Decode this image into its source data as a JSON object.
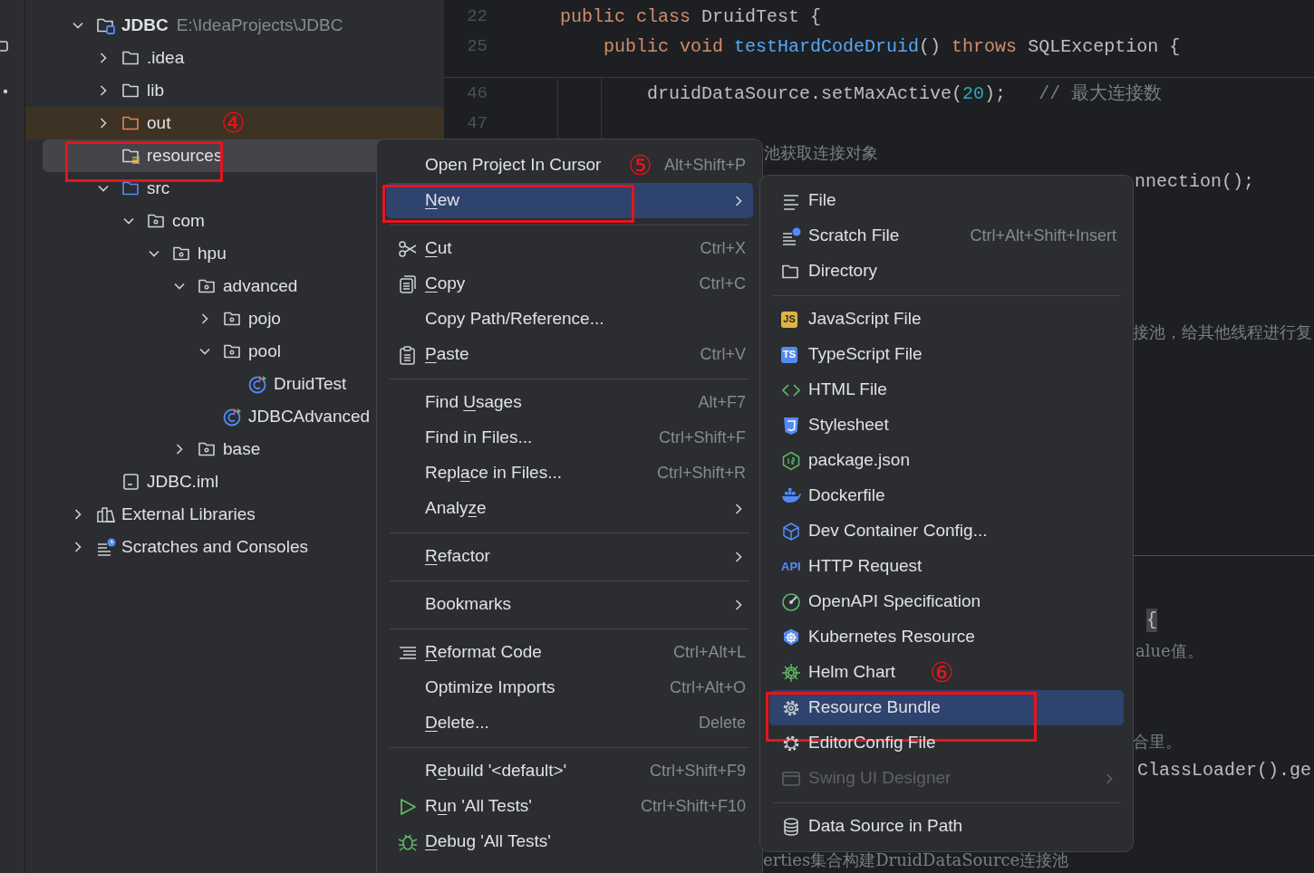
{
  "tree": [
    {
      "label": "JDBC",
      "path": "E:\\IdeaProjects\\JDBC",
      "kind": "project",
      "expanded": true,
      "selected": false,
      "children": [
        {
          "label": ".idea",
          "kind": "folder",
          "expanded": false,
          "selected": false
        },
        {
          "label": "lib",
          "kind": "folder",
          "expanded": false,
          "selected": false
        },
        {
          "label": "out",
          "kind": "excluded",
          "expanded": false,
          "selected": false,
          "callout": "④"
        },
        {
          "label": "resources",
          "kind": "resources",
          "selected": true,
          "boxed": true
        },
        {
          "label": "src",
          "kind": "source",
          "expanded": true,
          "selected": false,
          "children": [
            {
              "label": "com",
              "kind": "package",
              "expanded": true,
              "selected": false,
              "children": [
                {
                  "label": "hpu",
                  "kind": "package",
                  "expanded": true,
                  "selected": false,
                  "children": [
                    {
                      "label": "advanced",
                      "kind": "package",
                      "expanded": true,
                      "selected": false,
                      "children": [
                        {
                          "label": "pojo",
                          "kind": "package",
                          "expanded": false,
                          "selected": false
                        },
                        {
                          "label": "pool",
                          "kind": "package",
                          "expanded": true,
                          "selected": false,
                          "children": [
                            {
                              "label": "DruidTest",
                              "kind": "class",
                              "selected": false
                            }
                          ]
                        },
                        {
                          "label": "JDBCAdvanced",
                          "kind": "class",
                          "selected": false
                        }
                      ]
                    },
                    {
                      "label": "base",
                      "kind": "package",
                      "expanded": false,
                      "selected": false
                    }
                  ]
                }
              ]
            }
          ]
        },
        {
          "label": "JDBC.iml",
          "kind": "file",
          "selected": false
        }
      ]
    },
    {
      "label": "External Libraries",
      "kind": "libraries",
      "expanded": false,
      "selected": false
    },
    {
      "label": "Scratches and Consoles",
      "kind": "scratches",
      "expanded": false,
      "selected": false
    }
  ],
  "editor": {
    "sticky_lines": [
      {
        "number": "22",
        "tokens": [
          {
            "text": "    public class ",
            "kind": "keyword"
          },
          {
            "text": "DruidTest {",
            "kind": "plain"
          }
        ]
      },
      {
        "number": "25",
        "tokens": [
          {
            "text": "        public void ",
            "kind": "keyword"
          },
          {
            "text": "testHardCodeDruid",
            "kind": "method"
          },
          {
            "text": "() ",
            "kind": "plain"
          },
          {
            "text": "throws ",
            "kind": "keyword"
          },
          {
            "text": "SQLException {",
            "kind": "plain"
          }
        ]
      }
    ],
    "lines": [
      {
        "number": "46",
        "tokens": [
          {
            "text": "            druidDataSource.setMaxActive(",
            "kind": "plain"
          },
          {
            "text": "20",
            "kind": "number"
          },
          {
            "text": ");   ",
            "kind": "plain"
          },
          {
            "text": "// 最大连接数",
            "kind": "comment"
          }
        ]
      },
      {
        "number": "47"
      }
    ],
    "fragments": [
      {
        "text": "池获取连接对象",
        "kind": "comment"
      },
      {
        "text": "nnection();",
        "kind": "plain"
      },
      {
        "text": "接池，给其他线程进行复",
        "kind": "comment"
      },
      {
        "text": "{",
        "kind": "brace"
      },
      {
        "text": "alue值。",
        "kind": "comment"
      },
      {
        "text": "合里。",
        "kind": "comment"
      },
      {
        "text": "ClassLoader().ge",
        "kind": "plain"
      },
      {
        "text": "erties集合构建DruidDataSource连接池",
        "kind": "comment"
      }
    ]
  },
  "context_menu": [
    {
      "kind": "item",
      "label": "Open Project In Cursor",
      "shortcut": "Alt+Shift+P",
      "submenu": false,
      "selected": false,
      "callout": "⑤"
    },
    {
      "kind": "item",
      "label": {
        "key": "N",
        "post": "ew"
      },
      "submenu": true,
      "selected": true,
      "boxed": true
    },
    {
      "kind": "separator"
    },
    {
      "kind": "item",
      "label": {
        "key": "C",
        "post": "ut"
      },
      "shortcut": "Ctrl+X",
      "submenu": false,
      "selected": false
    },
    {
      "kind": "item",
      "label": {
        "key": "C",
        "post": "opy"
      },
      "shortcut": "Ctrl+C",
      "submenu": false,
      "selected": false
    },
    {
      "kind": "item",
      "label": "Copy Path/Reference...",
      "submenu": false,
      "selected": false
    },
    {
      "kind": "item",
      "label": {
        "key": "P",
        "post": "aste"
      },
      "shortcut": "Ctrl+V",
      "submenu": false,
      "selected": false
    },
    {
      "kind": "separator"
    },
    {
      "kind": "item",
      "label": {
        "pre": "Find ",
        "key": "U",
        "post": "sages"
      },
      "shortcut": "Alt+F7",
      "submenu": false,
      "selected": false
    },
    {
      "kind": "item",
      "label": "Find in Files...",
      "shortcut": "Ctrl+Shift+F",
      "submenu": false,
      "selected": false
    },
    {
      "kind": "item",
      "label": {
        "pre": "Repl",
        "key": "a",
        "post": "ce in Files..."
      },
      "shortcut": "Ctrl+Shift+R",
      "submenu": false,
      "selected": false
    },
    {
      "kind": "item",
      "label": {
        "pre": "Analy",
        "key": "z",
        "post": "e"
      },
      "submenu": true,
      "selected": false
    },
    {
      "kind": "separator"
    },
    {
      "kind": "item",
      "label": {
        "key": "R",
        "post": "efactor"
      },
      "submenu": true,
      "selected": false
    },
    {
      "kind": "separator"
    },
    {
      "kind": "item",
      "label": "Bookmarks",
      "submenu": true,
      "selected": false
    },
    {
      "kind": "separator"
    },
    {
      "kind": "item",
      "label": {
        "key": "R",
        "post": "eformat Code"
      },
      "shortcut": "Ctrl+Alt+L",
      "submenu": false,
      "selected": false
    },
    {
      "kind": "item",
      "label": "Optimize Imports",
      "shortcut": "Ctrl+Alt+O",
      "submenu": false,
      "selected": false
    },
    {
      "kind": "item",
      "label": {
        "key": "D",
        "post": "elete..."
      },
      "shortcut": "Delete",
      "submenu": false,
      "selected": false
    },
    {
      "kind": "separator"
    },
    {
      "kind": "item",
      "label": {
        "pre": "R",
        "key": "e",
        "post": "build '<default>'"
      },
      "shortcut": "Ctrl+Shift+F9",
      "submenu": false,
      "selected": false
    },
    {
      "kind": "item",
      "label": {
        "pre": "R",
        "key": "u",
        "post": "n 'All Tests'"
      },
      "shortcut": "Ctrl+Shift+F10",
      "submenu": false,
      "selected": false
    },
    {
      "kind": "item",
      "label": {
        "key": "D",
        "post": "ebug 'All Tests'"
      },
      "submenu": false,
      "selected": false
    }
  ],
  "new_submenu": [
    {
      "kind": "item",
      "label": "File",
      "submenu": false,
      "selected": false,
      "disabled": false
    },
    {
      "kind": "item",
      "label": "Scratch File",
      "shortcut": "Ctrl+Alt+Shift+Insert",
      "submenu": false,
      "selected": false,
      "disabled": false
    },
    {
      "kind": "item",
      "label": "Directory",
      "submenu": false,
      "selected": false,
      "disabled": false
    },
    {
      "kind": "separator"
    },
    {
      "kind": "item",
      "label": "JavaScript File",
      "icon_text": "JS",
      "submenu": false,
      "selected": false,
      "disabled": false
    },
    {
      "kind": "item",
      "label": "TypeScript File",
      "icon_text": "TS",
      "submenu": false,
      "selected": false,
      "disabled": false
    },
    {
      "kind": "item",
      "label": "HTML File",
      "submenu": false,
      "selected": false,
      "disabled": false
    },
    {
      "kind": "item",
      "label": "Stylesheet",
      "submenu": false,
      "selected": false,
      "disabled": false
    },
    {
      "kind": "item",
      "label": "package.json",
      "submenu": false,
      "selected": false,
      "disabled": false
    },
    {
      "kind": "item",
      "label": "Dockerfile",
      "submenu": false,
      "selected": false,
      "disabled": false
    },
    {
      "kind": "item",
      "label": "Dev Container Config...",
      "submenu": false,
      "selected": false,
      "disabled": false
    },
    {
      "kind": "item",
      "label": "HTTP Request",
      "icon_text": "API",
      "submenu": false,
      "selected": false,
      "disabled": false
    },
    {
      "kind": "item",
      "label": "OpenAPI Specification",
      "submenu": false,
      "selected": false,
      "disabled": false
    },
    {
      "kind": "item",
      "label": "Kubernetes Resource",
      "submenu": false,
      "selected": false,
      "disabled": false
    },
    {
      "kind": "item",
      "label": "Helm Chart",
      "submenu": false,
      "selected": false,
      "disabled": false,
      "callout": "⑥"
    },
    {
      "kind": "item",
      "label": "Resource Bundle",
      "submenu": false,
      "selected": true,
      "disabled": false,
      "boxed": true
    },
    {
      "kind": "item",
      "label": "EditorConfig File",
      "submenu": false,
      "selected": false,
      "disabled": false
    },
    {
      "kind": "item",
      "label": "Swing UI Designer",
      "submenu": true,
      "selected": false,
      "disabled": true
    },
    {
      "kind": "separator"
    },
    {
      "kind": "item",
      "label": "Data Source in Path",
      "submenu": false,
      "selected": false,
      "disabled": false
    }
  ]
}
